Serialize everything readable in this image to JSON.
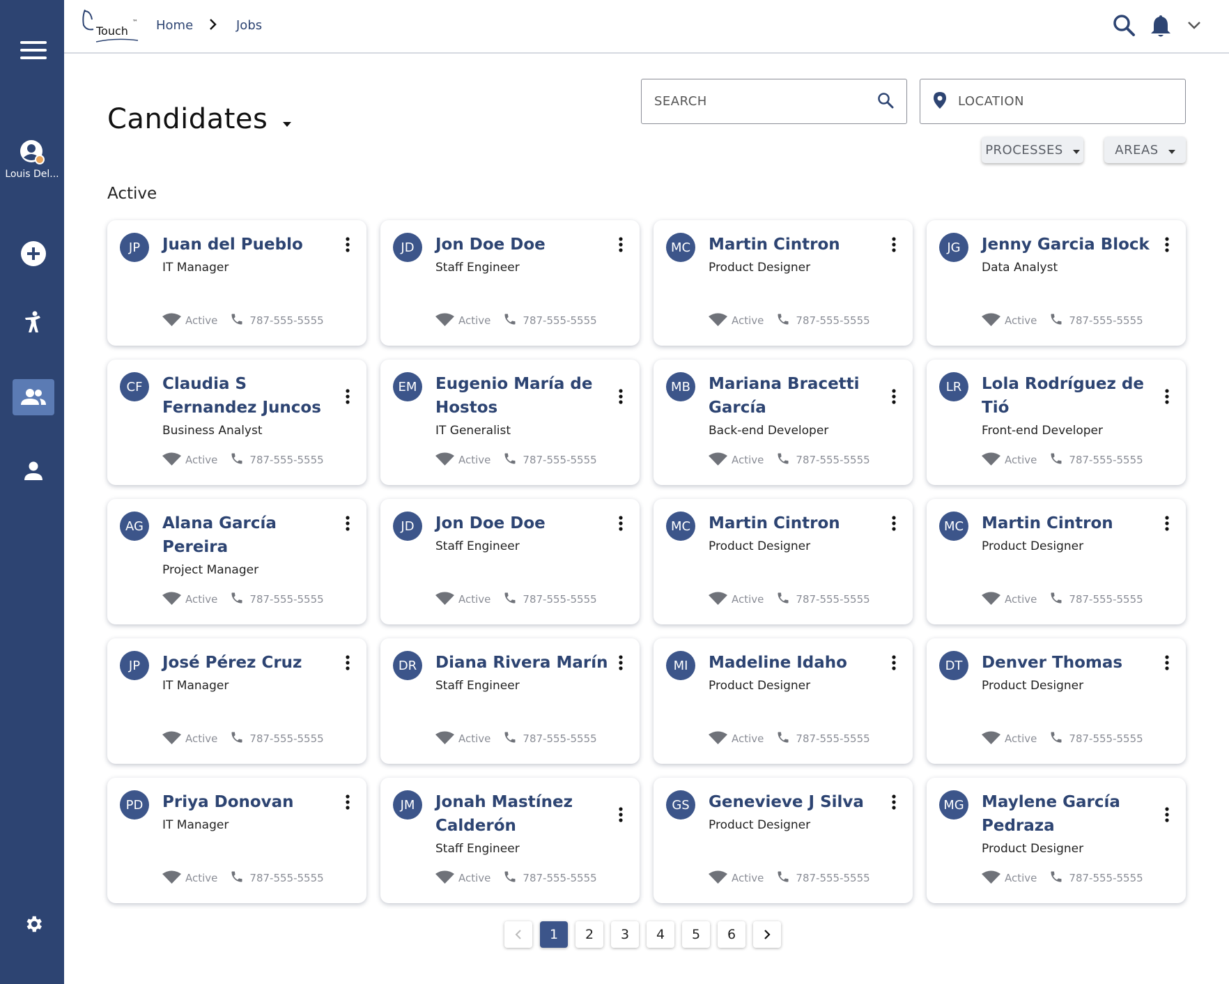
{
  "sidebar": {
    "user_name": "Louis Del...",
    "items": [
      "menu-icon",
      "plus-icon",
      "walker-icon",
      "people-icon",
      "person-icon",
      "gear-icon"
    ]
  },
  "topbar": {
    "logo_text": "Touch",
    "logo_tm": "™",
    "breadcrumb": [
      "Home",
      "Jobs"
    ]
  },
  "header": {
    "title": "Candidates",
    "search_placeholder": "SEARCH",
    "location_placeholder": "LOCATION",
    "filters": [
      "PROCESSES",
      "AREAS"
    ],
    "section": "Active"
  },
  "colors": {
    "primary": "#2d4472",
    "avatar": "#3c558a",
    "active_sidebar": "#5b7bb4"
  },
  "candidates": [
    {
      "initials": "JP",
      "name": "Juan del Pueblo",
      "role": "IT Manager",
      "status": "Active",
      "phone": "787-555-5555"
    },
    {
      "initials": "JD",
      "name": "Jon Doe Doe",
      "role": "Staff Engineer",
      "status": "Active",
      "phone": "787-555-5555"
    },
    {
      "initials": "MC",
      "name": "Martin Cintron",
      "role": "Product Designer",
      "status": "Active",
      "phone": "787-555-5555"
    },
    {
      "initials": "JG",
      "name": "Jenny Garcia Block",
      "role": "Data Analyst",
      "status": "Active",
      "phone": "787-555-5555"
    },
    {
      "initials": "CF",
      "name": "Claudia S Fernandez Juncos",
      "role": "Business Analyst",
      "status": "Active",
      "phone": "787-555-5555"
    },
    {
      "initials": "EM",
      "name": "Eugenio María de Hostos",
      "role": "IT Generalist",
      "status": "Active",
      "phone": "787-555-5555"
    },
    {
      "initials": "MB",
      "name": "Mariana Bracetti García",
      "role": "Back-end Developer",
      "status": "Active",
      "phone": "787-555-5555"
    },
    {
      "initials": "LR",
      "name": "Lola Rodríguez de Tió",
      "role": "Front-end Developer",
      "status": "Active",
      "phone": "787-555-5555"
    },
    {
      "initials": "AG",
      "name": "Alana García Pereira",
      "role": "Project Manager",
      "status": "Active",
      "phone": "787-555-5555"
    },
    {
      "initials": "JD",
      "name": "Jon Doe Doe",
      "role": "Staff Engineer",
      "status": "Active",
      "phone": "787-555-5555"
    },
    {
      "initials": "MC",
      "name": "Martin Cintron",
      "role": "Product Designer",
      "status": "Active",
      "phone": "787-555-5555"
    },
    {
      "initials": "MC",
      "name": "Martin Cintron",
      "role": "Product Designer",
      "status": "Active",
      "phone": "787-555-5555"
    },
    {
      "initials": "JP",
      "name": "José Pérez Cruz",
      "role": "IT Manager",
      "status": "Active",
      "phone": "787-555-5555"
    },
    {
      "initials": "DR",
      "name": "Diana Rivera Marín",
      "role": "Staff Engineer",
      "status": "Active",
      "phone": "787-555-5555"
    },
    {
      "initials": "MI",
      "name": "Madeline Idaho",
      "role": "Product Designer",
      "status": "Active",
      "phone": "787-555-5555"
    },
    {
      "initials": "DT",
      "name": "Denver Thomas",
      "role": "Product Designer",
      "status": "Active",
      "phone": "787-555-5555"
    },
    {
      "initials": "PD",
      "name": "Priya Donovan",
      "role": "IT Manager",
      "status": "Active",
      "phone": "787-555-5555"
    },
    {
      "initials": "JM",
      "name": "Jonah Mastínez Calderón",
      "role": "Staff Engineer",
      "status": "Active",
      "phone": "787-555-5555"
    },
    {
      "initials": "GS",
      "name": "Genevieve J Silva",
      "role": "Product Designer",
      "status": "Active",
      "phone": "787-555-5555"
    },
    {
      "initials": "MG",
      "name": "Maylene García Pedraza",
      "role": "Product Designer",
      "status": "Active",
      "phone": "787-555-5555"
    }
  ],
  "pagination": {
    "pages": [
      "1",
      "2",
      "3",
      "4",
      "5",
      "6"
    ],
    "current": "1"
  }
}
